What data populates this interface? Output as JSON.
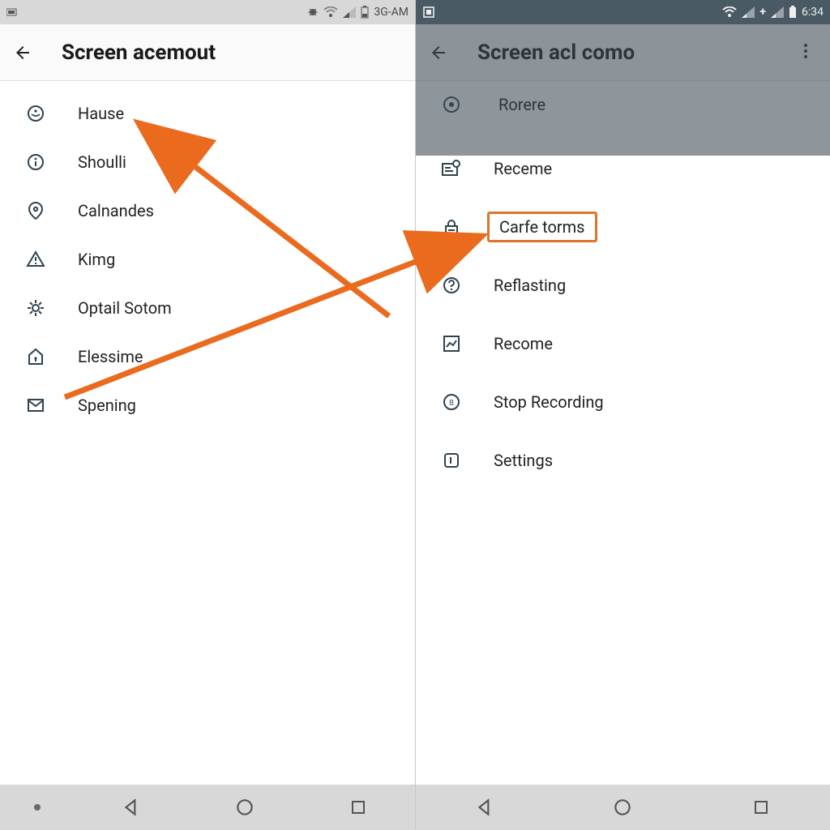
{
  "left": {
    "statusbar": {
      "net": "3G-AM"
    },
    "appbar": {
      "title": "Screen acemout"
    },
    "items": [
      {
        "label": "Hause"
      },
      {
        "label": "Shoulli"
      },
      {
        "label": "Calnandes"
      },
      {
        "label": "Kimg"
      },
      {
        "label": "Optail Sotom"
      },
      {
        "label": "Elessime"
      },
      {
        "label": "Spening"
      }
    ]
  },
  "right": {
    "statusbar": {
      "time": "6:34"
    },
    "appbar": {
      "title": "Screen acl como"
    },
    "dimmed_items": [
      {
        "label": "Rorere"
      }
    ],
    "items": [
      {
        "label": "Receme"
      },
      {
        "label": "Carfe torms",
        "highlighted": true
      },
      {
        "label": "Reflasting"
      },
      {
        "label": "Recome"
      },
      {
        "label": "Stop Recording"
      },
      {
        "label": "Settings"
      }
    ]
  },
  "colors": {
    "accent": "#e2732a"
  }
}
